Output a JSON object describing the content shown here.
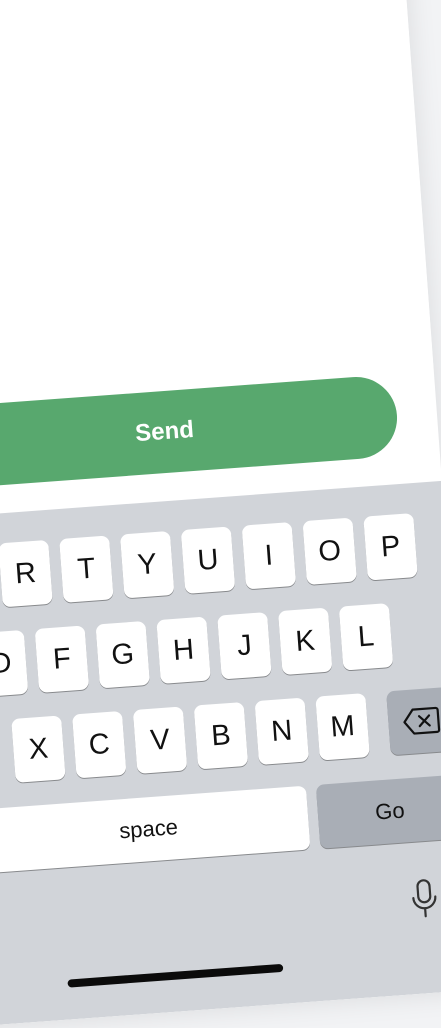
{
  "send_button": {
    "label": "Send"
  },
  "keyboard": {
    "row1": [
      "R",
      "T",
      "Y",
      "U",
      "I",
      "O",
      "P"
    ],
    "row2": [
      "D",
      "F",
      "G",
      "H",
      "J",
      "K",
      "L"
    ],
    "row3": [
      "X",
      "C",
      "V",
      "B",
      "N",
      "M"
    ],
    "space_label": "space",
    "go_label": "Go",
    "delete_icon": "delete-backspace-icon",
    "mic_icon": "microphone-icon"
  },
  "colors": {
    "send_button": "#58a86e",
    "keyboard_bg": "#d1d4d9",
    "key_bg": "#ffffff",
    "special_key_bg": "#a9aeb6"
  }
}
